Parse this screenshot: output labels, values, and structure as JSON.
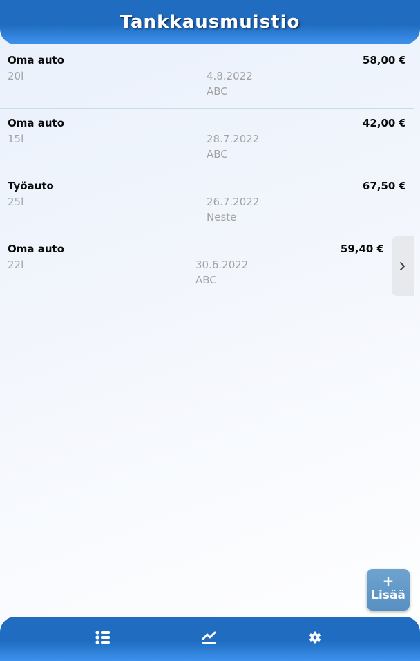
{
  "header": {
    "title": "Tankkausmuistio"
  },
  "entries": [
    {
      "car": "Oma auto",
      "price": "58,00 €",
      "liters": "20l",
      "date": "4.8.2022",
      "station": "ABC"
    },
    {
      "car": "Oma auto",
      "price": "42,00 €",
      "liters": "15l",
      "date": "28.7.2022",
      "station": "ABC"
    },
    {
      "car": "Työauto",
      "price": "67,50 €",
      "liters": "25l",
      "date": "26.7.2022",
      "station": "Neste"
    },
    {
      "car": "Oma auto",
      "price": "59,40 €",
      "liters": "22l",
      "date": "30.6.2022",
      "station": "ABC"
    }
  ],
  "fab": {
    "plus": "+",
    "label": "Lisää"
  },
  "tabs": [
    {
      "icon": "list-icon"
    },
    {
      "icon": "chart-icon"
    },
    {
      "icon": "gear-icon"
    }
  ],
  "colors": {
    "bar": "#1f6cc0",
    "bar_light": "#3e92ee",
    "fab": "#5f97c7"
  }
}
